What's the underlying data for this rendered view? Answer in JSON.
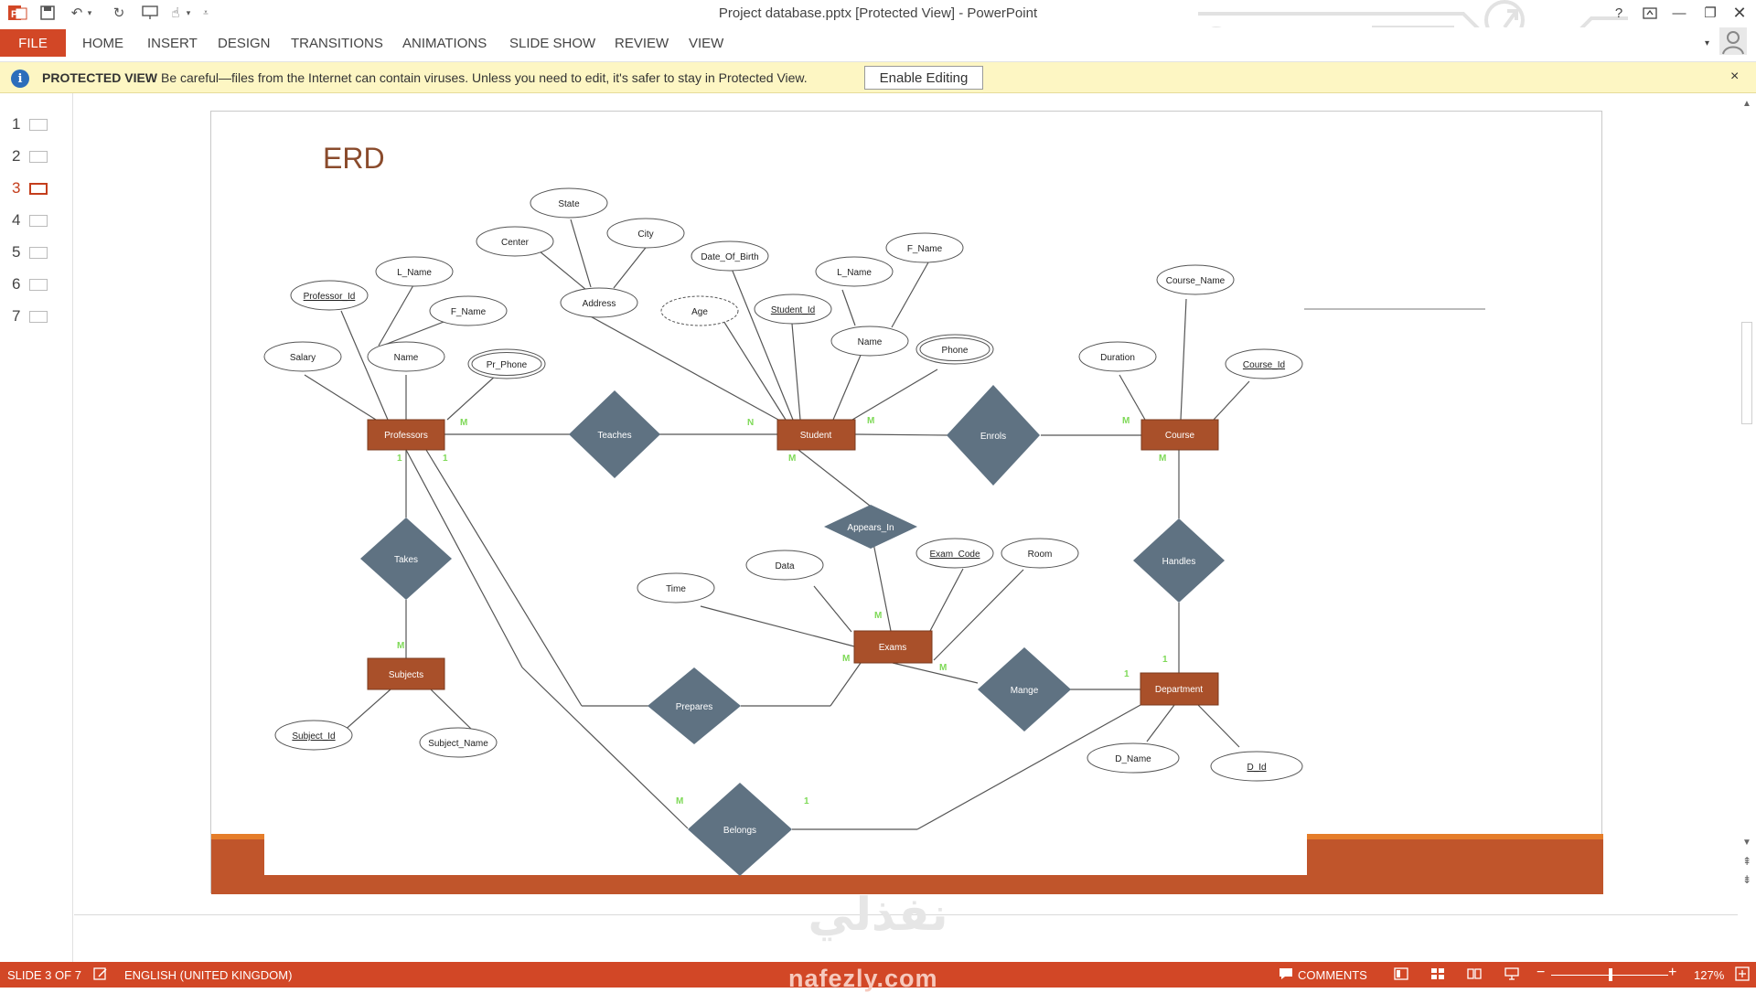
{
  "app": {
    "window_title": "Project database.pptx [Protected View] - PowerPoint"
  },
  "ribbon": {
    "file": "FILE",
    "tabs": [
      "HOME",
      "INSERT",
      "DESIGN",
      "TRANSITIONS",
      "ANIMATIONS",
      "SLIDE SHOW",
      "REVIEW",
      "VIEW"
    ]
  },
  "protected_view": {
    "title": "PROTECTED VIEW",
    "message": "Be careful—files from the Internet can contain viruses. Unless you need to edit, it's safer to stay in Protected View.",
    "button": "Enable Editing",
    "close": "×"
  },
  "thumbnails": {
    "numbers": [
      "1",
      "2",
      "3",
      "4",
      "5",
      "6",
      "7"
    ],
    "active": "3"
  },
  "slide": {
    "title": "ERD",
    "entities": [
      "Professors",
      "Student",
      "Course",
      "Subjects",
      "Exams",
      "Department"
    ],
    "relationships": [
      "Teaches",
      "Enrols",
      "Takes",
      "Appears_In",
      "Handles",
      "Prepares",
      "Mange",
      "Belongs"
    ],
    "attributes": [
      "State",
      "Center",
      "City",
      "Address",
      "L_Name",
      "Professor_Id",
      "F_Name",
      "Salary",
      "Name",
      "Pr_Phone",
      "Date_Of_Birth",
      "F_Name",
      "L_Name",
      "Age",
      "Student_Id",
      "Name",
      "Phone",
      "Course_Name",
      "Duration",
      "Course_Id",
      "Time",
      "Data",
      "Exam_Code",
      "Room",
      "Subject_Id",
      "Subject_Name",
      "D_Name",
      "D_Id"
    ],
    "cardinalities": [
      "M",
      "1",
      "1",
      "N",
      "M",
      "M",
      "M",
      "M",
      "M",
      "M",
      "M",
      "M",
      "1",
      "1",
      "M",
      "1"
    ]
  },
  "status": {
    "slide": "SLIDE 3 OF 7",
    "language": "ENGLISH (UNITED KINGDOM)",
    "comments": "COMMENTS",
    "zoom": "127%",
    "zoom_level_percent": 127
  },
  "watermark": {
    "arabic": "نفذلي",
    "latin": "nafezly.com"
  },
  "colors": {
    "accent": "#d24726",
    "entity_fill": "#a9502a",
    "relationship_fill": "#5f7282",
    "slide_title": "#8a4b2c",
    "cardinality": "#7ed957",
    "protected_bar": "#fdf6c3"
  },
  "icons": [
    "powerpoint-logo-icon",
    "save-icon",
    "undo-icon",
    "redo-icon",
    "start-slideshow-icon",
    "touch-mode-icon",
    "customize-qat-icon",
    "help-icon",
    "ribbon-display-icon",
    "minimize-icon",
    "restore-icon",
    "close-icon",
    "user-account-icon",
    "info-icon",
    "notes-icon",
    "comments-icon",
    "normal-view-icon",
    "slide-sorter-icon",
    "reading-view-icon",
    "slideshow-view-icon",
    "fit-slide-icon"
  ]
}
